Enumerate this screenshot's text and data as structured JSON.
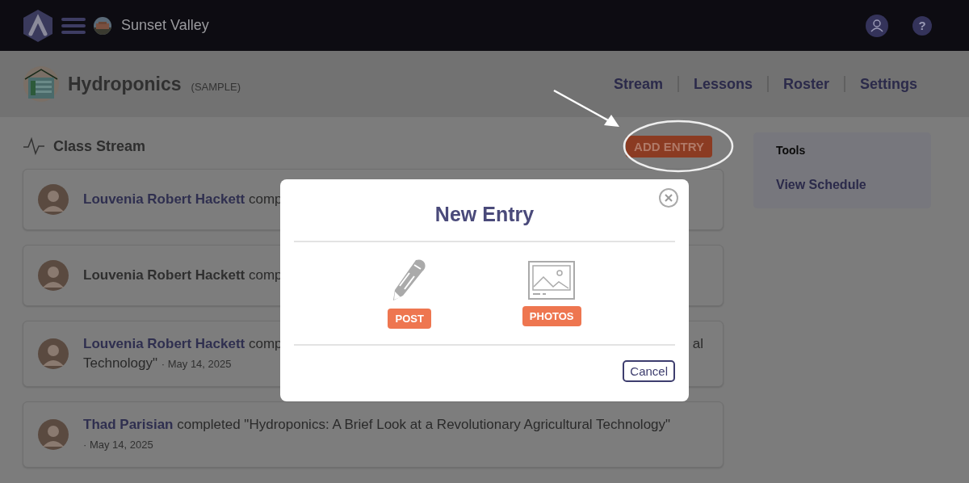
{
  "topbar": {
    "school": "Sunset Valley",
    "help_glyph": "?"
  },
  "course": {
    "title": "Hydroponics",
    "tag": "(SAMPLE)"
  },
  "nav": [
    {
      "label": "Stream"
    },
    {
      "label": "Lessons"
    },
    {
      "label": "Roster"
    },
    {
      "label": "Settings"
    }
  ],
  "stream": {
    "title": "Class Stream",
    "add_button": "ADD ENTRY",
    "items": [
      {
        "name": "Louvenia Robert Hackett",
        "name_linked": true,
        "text": "comp"
      },
      {
        "name": "Louvenia Robert Hackett",
        "name_linked": false,
        "text": "comp"
      },
      {
        "name": "Louvenia Robert Hackett",
        "name_linked": true,
        "text": "comp",
        "tail": "al",
        "continuation": "Technology\"",
        "date": "· May 14, 2025"
      },
      {
        "name": "Thad Parisian",
        "name_linked": true,
        "text": "completed \"Hydroponics: A Brief Look at a Revolutionary Agricultural Technology\"",
        "date": "· May 14, 2025"
      }
    ]
  },
  "tools": {
    "title": "Tools",
    "items": [
      "View Schedule"
    ]
  },
  "modal": {
    "title": "New Entry",
    "options": [
      {
        "kind": "post",
        "label": "POST"
      },
      {
        "kind": "photos",
        "label": "PHOTOS"
      }
    ],
    "cancel": "Cancel"
  }
}
